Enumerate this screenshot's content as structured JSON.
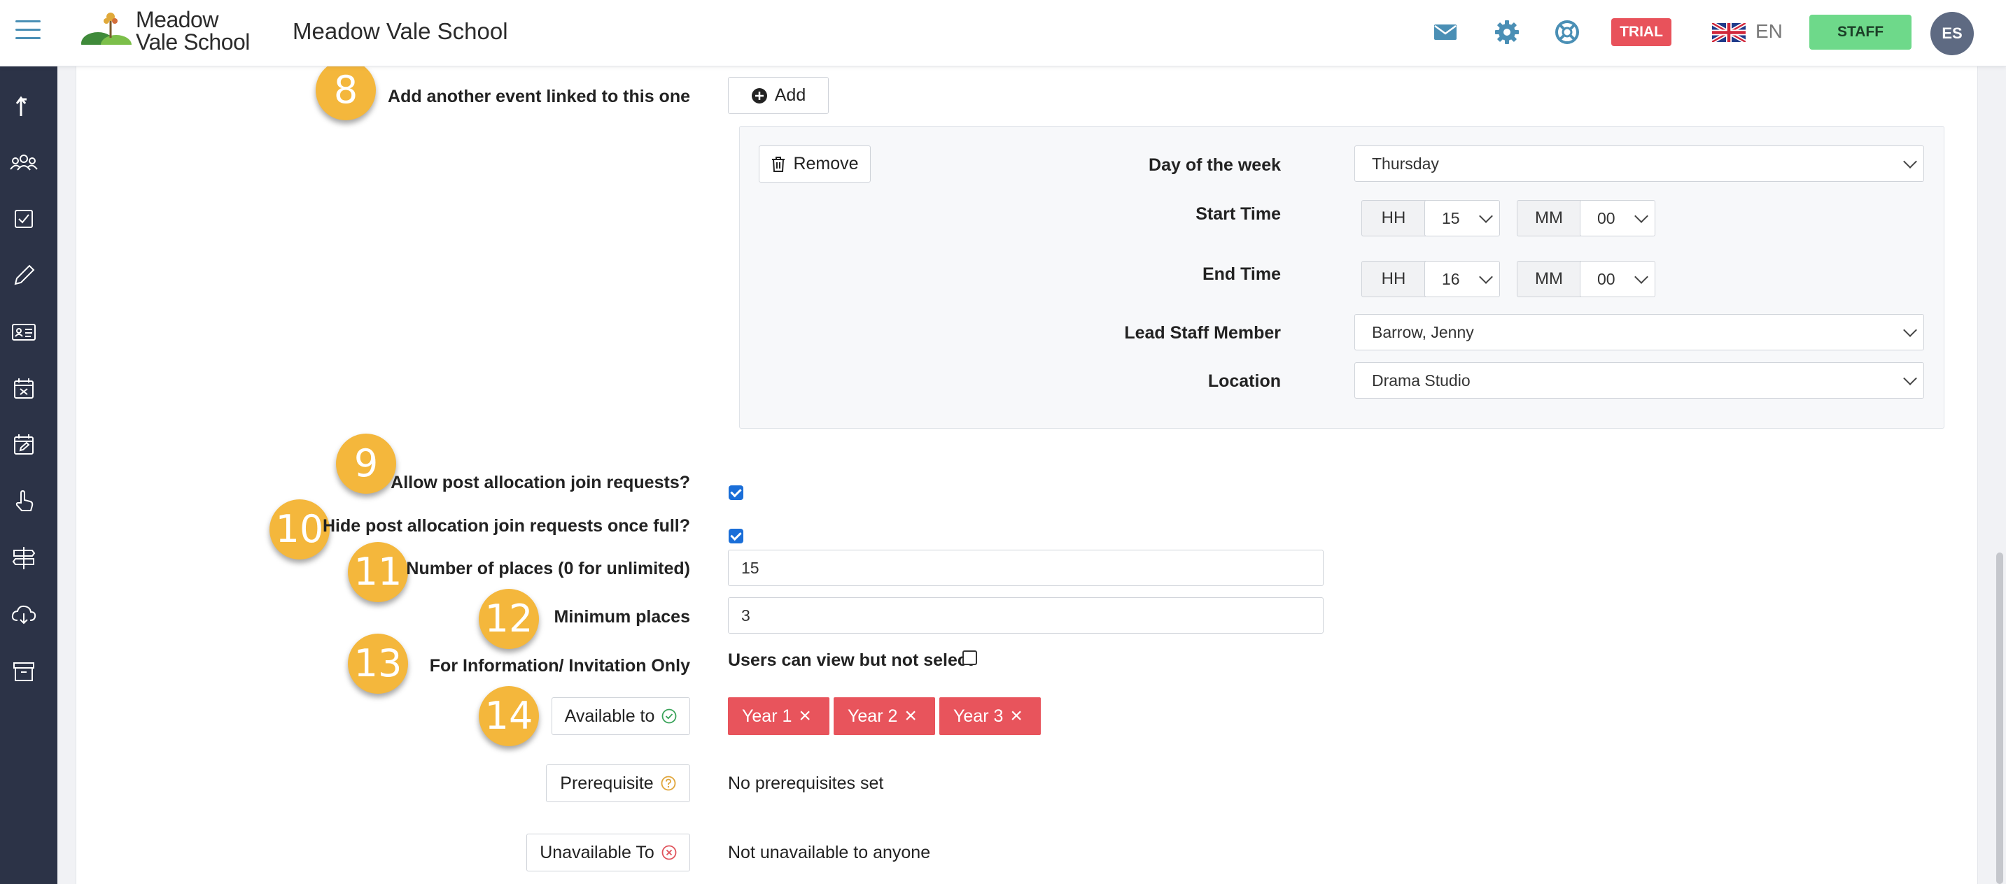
{
  "header": {
    "logo_line1": "Meadow",
    "logo_line2": "Vale School",
    "title": "Meadow Vale School",
    "trial_label": "TRIAL",
    "language": "EN",
    "staff_label": "STAFF",
    "avatar_initials": "ES"
  },
  "sidebar": {
    "icons": [
      "share-arrow-icon",
      "users-icon",
      "checklist-icon",
      "pencil-icon",
      "id-card-icon",
      "calendar-x-icon",
      "calendar-edit-icon",
      "hand-pointer-icon",
      "signpost-icon",
      "cloud-download-icon",
      "archive-icon"
    ]
  },
  "form": {
    "linked_event": {
      "badge": "8",
      "label": "Add another event linked to this one",
      "add_label": "Add"
    },
    "event_panel": {
      "remove_label": "Remove",
      "day_label": "Day of the week",
      "day_value": "Thursday",
      "start_label": "Start Time",
      "start_hh_label": "HH",
      "start_hh_value": "15",
      "start_mm_label": "MM",
      "start_mm_value": "00",
      "end_label": "End Time",
      "end_hh_label": "HH",
      "end_hh_value": "16",
      "end_mm_label": "MM",
      "end_mm_value": "00",
      "lead_label": "Lead Staff Member",
      "lead_value": "Barrow, Jenny",
      "location_label": "Location",
      "location_value": "Drama Studio"
    },
    "join_requests": {
      "badge": "9",
      "label": "Allow post allocation join requests?",
      "checked": true
    },
    "hide_requests": {
      "badge": "10",
      "label": "Hide post allocation join requests once full?",
      "checked": true
    },
    "places": {
      "badge": "11",
      "label": "Number of places (0 for unlimited)",
      "value": "15"
    },
    "min_places": {
      "badge": "12",
      "label": "Minimum places",
      "value": "3"
    },
    "info_only": {
      "badge": "13",
      "label": "For Information/ Invitation Only",
      "option_text": "Users can view but not select",
      "checked": false
    },
    "available_to": {
      "badge": "14",
      "button_label": "Available to",
      "tags": [
        "Year 1",
        "Year 2",
        "Year 3"
      ]
    },
    "prerequisite": {
      "button_label": "Prerequisite",
      "text": "No prerequisites set"
    },
    "unavailable_to": {
      "button_label": "Unavailable To",
      "text": "Not unavailable to anyone"
    }
  },
  "colors": {
    "sidebar": "#2c3347",
    "badge": "#f4b73c",
    "tag": "#e8545c",
    "trial": "#e8525b",
    "staff": "#6ed98a",
    "accent": "#4a8fb5"
  }
}
